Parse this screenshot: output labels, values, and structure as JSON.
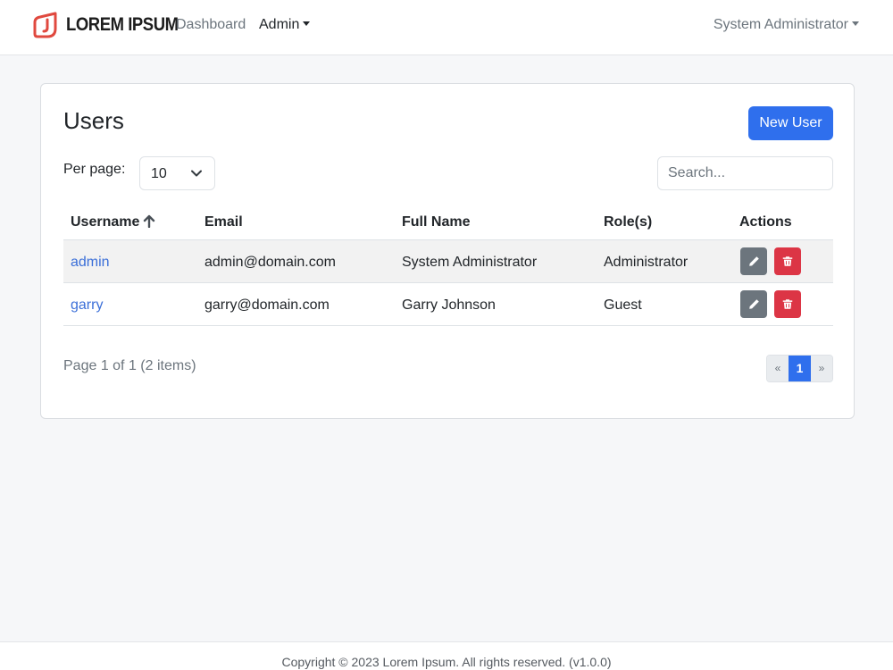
{
  "brand": {
    "name": "LOREM IPSUM",
    "logo_color": "#e0493f"
  },
  "nav": {
    "dashboard": "Dashboard",
    "admin": "Admin",
    "user_menu": "System Administrator"
  },
  "users": {
    "title": "Users",
    "new_button": "New User",
    "per_page_label": "Per page:",
    "per_page_value": "10",
    "search_placeholder": "Search...",
    "columns": [
      "Username",
      "Email",
      "Full Name",
      "Role(s)",
      "Actions"
    ],
    "sort": {
      "column": "Username",
      "direction": "ascending"
    },
    "rows": [
      {
        "username": "admin",
        "email": "admin@domain.com",
        "full_name": "System Administrator",
        "roles": "Administrator"
      },
      {
        "username": "garry",
        "email": "garry@domain.com",
        "full_name": "Garry Johnson",
        "roles": "Guest"
      }
    ],
    "page_info": "Page 1 of 1 (2 items)",
    "pagination": {
      "prev": "«",
      "current": "1",
      "next": "»"
    }
  },
  "footer": {
    "text": "Copyright © 2023 Lorem Ipsum. All rights reserved. (v1.0.0)"
  },
  "colors": {
    "primary": "#2f6fed",
    "edit": "#6c757d",
    "delete": "#dc3545",
    "link": "#3b6fd8"
  },
  "icons": {
    "sort": "arrow-up-icon",
    "edit": "pencil-icon",
    "delete": "trash-icon",
    "chevron": "chevron-down-icon"
  }
}
